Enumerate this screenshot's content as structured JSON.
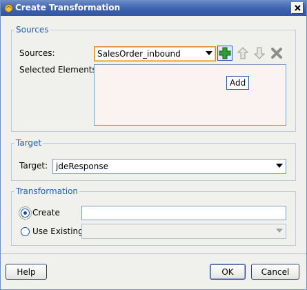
{
  "window": {
    "title": "Create Transformation"
  },
  "sources": {
    "group_label": "Sources",
    "sources_label": "Sources:",
    "sources_value": "SalesOrder_inbound",
    "selected_label": "Selected Elements:",
    "add_tooltip": "Add"
  },
  "target": {
    "group_label": "Target",
    "target_label": "Target:",
    "target_value": "jdeResponse"
  },
  "transformation": {
    "group_label": "Transformation",
    "create_label": "Create",
    "create_value": "",
    "use_existing_label": "Use Existing",
    "use_existing_value": "",
    "selected_option": "Create"
  },
  "buttons": {
    "help": "Help",
    "ok": "OK",
    "cancel": "Cancel"
  },
  "colors": {
    "group_label": "#1f5fb8",
    "titlebar": "#3f64b0",
    "add_icon": "#2e9e2e"
  }
}
